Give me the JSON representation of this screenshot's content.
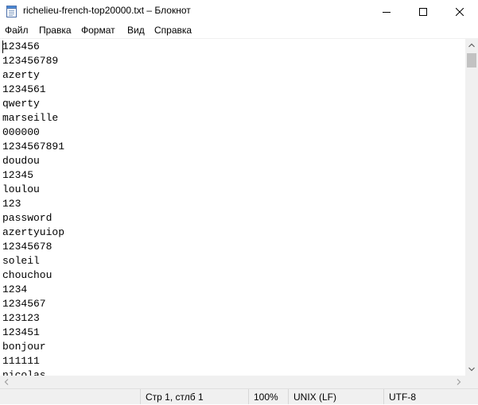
{
  "window": {
    "title": "richelieu-french-top20000.txt – Блокнот",
    "app_icon": "notepad-icon",
    "controls": [
      "minimize-icon",
      "maximize-icon",
      "close-icon"
    ]
  },
  "menu": {
    "items": [
      {
        "label": "Файл"
      },
      {
        "label": "Правка"
      },
      {
        "label": "Формат"
      },
      {
        "label": "Вид"
      },
      {
        "label": "Справка"
      }
    ]
  },
  "editor": {
    "lines": [
      "123456",
      "123456789",
      "azerty",
      "1234561",
      "qwerty",
      "marseille",
      "000000",
      "1234567891",
      "doudou",
      "12345",
      "loulou",
      "123",
      "password",
      "azertyuiop",
      "12345678",
      "soleil",
      "chouchou",
      "1234",
      "1234567",
      "123123",
      "123451",
      "bonjour",
      "111111",
      "nicolas"
    ]
  },
  "status": {
    "position": "Стр 1, стлб 1",
    "zoom": "100%",
    "line_endings": "UNIX (LF)",
    "encoding": "UTF-8"
  },
  "colors": {
    "chrome_bg": "#f0f0f0",
    "editor_bg": "#ffffff",
    "scroll_thumb": "#c2c2c2"
  }
}
